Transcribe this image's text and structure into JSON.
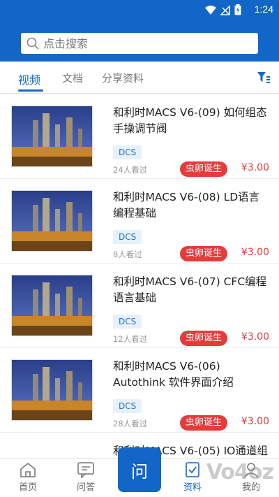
{
  "status": {
    "time": "1:24"
  },
  "search": {
    "placeholder": "点击搜索"
  },
  "tabs": [
    {
      "label": "视频",
      "active": true
    },
    {
      "label": "文档",
      "active": false
    },
    {
      "label": "分享资料",
      "active": false
    }
  ],
  "items": [
    {
      "title": "和利时MACS V6-(09) 如何组态手操调节阀",
      "tag": "DCS",
      "views": "24人看过",
      "badge": "虫卵诞生",
      "price": "¥3.00"
    },
    {
      "title": "和利时MACS V6-(08) LD语言编程基础",
      "tag": "DCS",
      "views": "8人看过",
      "badge": "虫卵诞生",
      "price": "¥3.00"
    },
    {
      "title": "和利时MACS V6-(07) CFC编程语言基础",
      "tag": "DCS",
      "views": "12人看过",
      "badge": "虫卵诞生",
      "price": "¥3.00"
    },
    {
      "title": "和利时MACS V6-(06) Autothink 软件界面介绍",
      "tag": "DCS",
      "views": "28人看过",
      "badge": "虫卵诞生",
      "price": "¥3.00"
    },
    {
      "title": "和利时MACS V6-(05) IO通道组"
    }
  ],
  "nav": {
    "home": "首页",
    "qa": "问答",
    "ask": "问",
    "materials": "资料",
    "mine": "我的"
  },
  "watermark": "Vo4oz",
  "colors": {
    "primary": "#1166c8",
    "accent": "#e53b3b",
    "tag_bg": "#e7f1fb"
  }
}
